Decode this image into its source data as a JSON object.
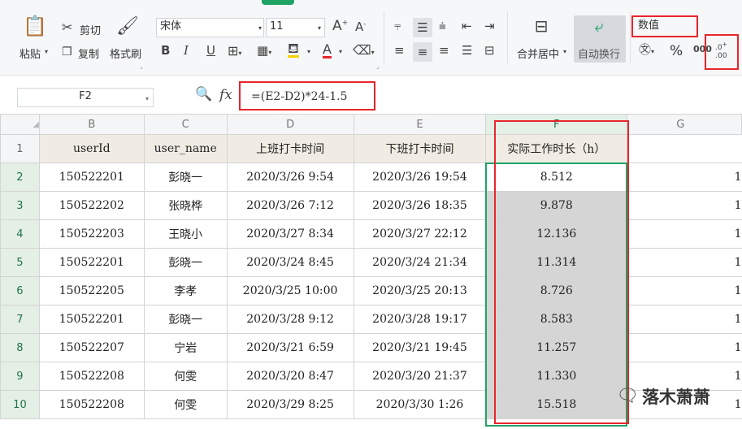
{
  "ribbon": {
    "paste_label": "粘贴",
    "cut_label": "剪切",
    "copy_label": "复制",
    "format_painter_label": "格式刷",
    "font_name": "宋体",
    "font_size": "11",
    "merge_center_label": "合并居中",
    "wrap_text_label": "自动换行",
    "number_format": "数值",
    "percent_symbol": "%"
  },
  "formula_bar": {
    "cell_ref": "F2",
    "fx_label": "fx",
    "formula": "=(E2-D2)*24-1.5"
  },
  "columns": [
    "B",
    "C",
    "D",
    "E",
    "F",
    "G"
  ],
  "header_row": {
    "row_num": "1",
    "cells": [
      "userId",
      "user_name",
      "上班打卡时间",
      "下班打卡时间",
      "实际工作时长（h）"
    ]
  },
  "rows": [
    {
      "row_num": "2",
      "cells": [
        "150522201",
        "彭晓一",
        "2020/3/26 9:54",
        "2020/3/26 19:54",
        "8.512"
      ],
      "g": "1"
    },
    {
      "row_num": "3",
      "cells": [
        "150522202",
        "张晓桦",
        "2020/3/26 7:12",
        "2020/3/26 18:35",
        "9.878"
      ],
      "g": "1"
    },
    {
      "row_num": "4",
      "cells": [
        "150522203",
        "王晓小",
        "2020/3/27 8:34",
        "2020/3/27 22:12",
        "12.136"
      ],
      "g": "1"
    },
    {
      "row_num": "5",
      "cells": [
        "150522201",
        "彭晓一",
        "2020/3/24 8:45",
        "2020/3/24 21:34",
        "11.314"
      ],
      "g": "1"
    },
    {
      "row_num": "6",
      "cells": [
        "150522205",
        "李孝",
        "2020/3/25 10:00",
        "2020/3/25 20:13",
        "8.726"
      ],
      "g": "1"
    },
    {
      "row_num": "7",
      "cells": [
        "150522201",
        "彭晓一",
        "2020/3/28 9:12",
        "2020/3/28 19:17",
        "8.583"
      ],
      "g": "1"
    },
    {
      "row_num": "8",
      "cells": [
        "150522207",
        "宁岩",
        "2020/3/21 6:59",
        "2020/3/21 19:45",
        "11.257"
      ],
      "g": "1"
    },
    {
      "row_num": "9",
      "cells": [
        "150522208",
        "何雯",
        "2020/3/20 8:47",
        "2020/3/20 21:37",
        "11.330"
      ],
      "g": "1"
    },
    {
      "row_num": "10",
      "cells": [
        "150522208",
        "何雯",
        "2020/3/29 8:25",
        "2020/3/30 1:26",
        "15.518"
      ],
      "g": "1"
    }
  ],
  "watermark": {
    "text": "落木萧萧"
  },
  "colors": {
    "accent_green": "#217346",
    "highlight_red": "#e8252b",
    "font_red": "#e8252b"
  }
}
